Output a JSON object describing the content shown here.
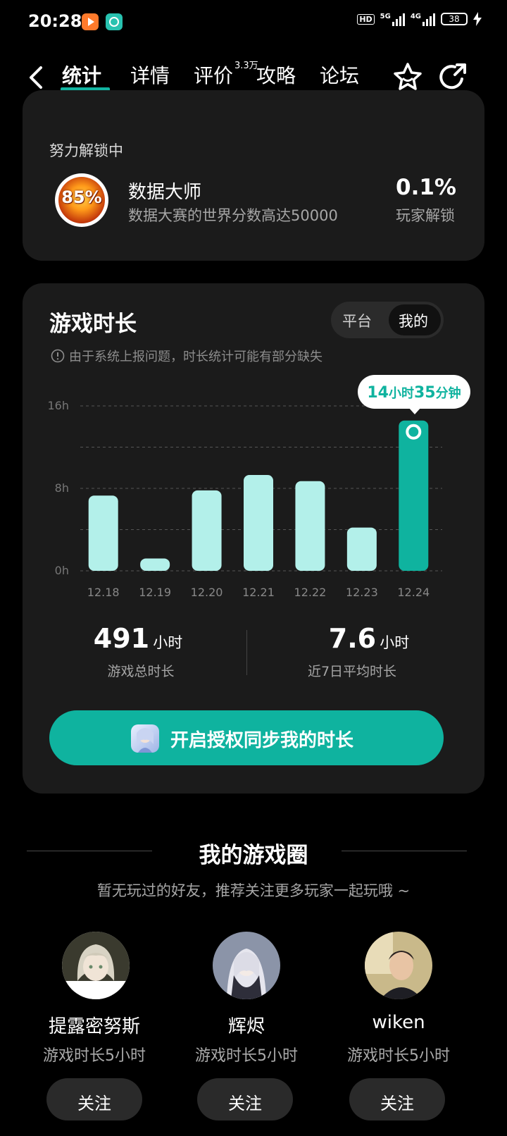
{
  "status": {
    "time": "20:28",
    "hd": "HD",
    "net1": "5G",
    "net2": "4G",
    "battery": "38"
  },
  "nav": {
    "tabs": [
      "统计",
      "详情",
      "评价",
      "攻略",
      "论坛"
    ],
    "review_count": "3.3万"
  },
  "achievement": {
    "section_label": "努力解锁中",
    "badge_text": "85%",
    "title": "数据大师",
    "description": "数据大赛的世界分数高达50000",
    "percent": "0.1%",
    "percent_label": "玩家解锁"
  },
  "playtime": {
    "title": "游戏时长",
    "toggle": {
      "option_platform": "平台",
      "option_mine": "我的",
      "selected": "我的"
    },
    "notice": "由于系统上报问题，时长统计可能有部分缺失",
    "tooltip": {
      "hours": "14",
      "hours_unit": "小时",
      "minutes": "35",
      "minutes_unit": "分钟"
    },
    "total_value": "491",
    "total_unit": "小时",
    "total_label": "游戏总时长",
    "avg_value": "7.6",
    "avg_unit": "小时",
    "avg_label": "近7日平均时长",
    "sync_button": "开启授权同步我的时长"
  },
  "chart_data": {
    "type": "bar",
    "categories": [
      "12.18",
      "12.19",
      "12.20",
      "12.21",
      "12.22",
      "12.23",
      "12.24"
    ],
    "values": [
      7.3,
      1.2,
      7.8,
      9.3,
      8.7,
      4.2,
      14.58
    ],
    "highlight_index": 6,
    "y_ticks": [
      "0h",
      "8h",
      "16h"
    ],
    "ylim": [
      0,
      16
    ],
    "colors": {
      "bar": "#b3f0ea",
      "highlight": "#0fb39f"
    }
  },
  "circle": {
    "title": "我的游戏圈",
    "subtitle": "暂无玩过的好友，推荐关注更多玩家一起玩哦 ~",
    "friends": [
      {
        "name": "提露密努斯",
        "playtime": "游戏时长5小时",
        "follow": "关注"
      },
      {
        "name": "辉烬",
        "playtime": "游戏时长5小时",
        "follow": "关注"
      },
      {
        "name": "wiken",
        "playtime": "游戏时长5小时",
        "follow": "关注"
      }
    ]
  }
}
